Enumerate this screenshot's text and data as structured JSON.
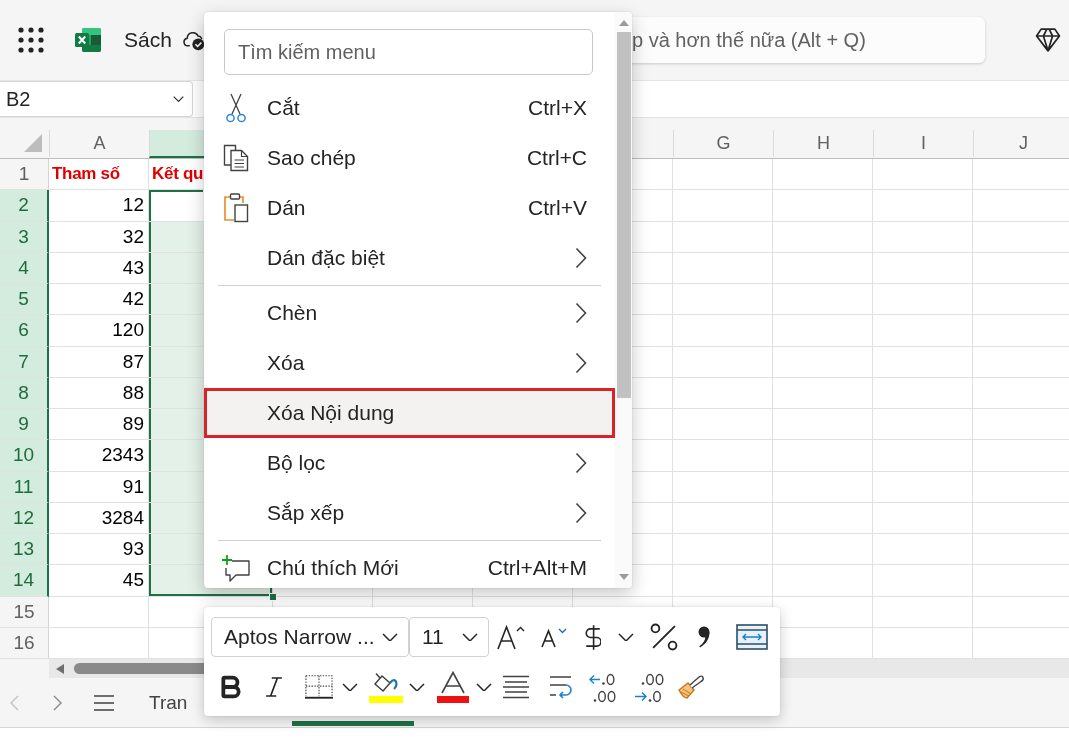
{
  "top_bar": {
    "document_title": "Sách",
    "search": {
      "placeholder": "p và hơn thế nữa (Alt + Q)"
    }
  },
  "name_box": {
    "value": "B2"
  },
  "columns": [
    {
      "label": "A",
      "selected": false
    },
    {
      "selected": true
    },
    {
      "label": "G",
      "selected": false
    },
    {
      "label": "H",
      "selected": false
    },
    {
      "label": "I",
      "selected": false
    },
    {
      "label": "J",
      "selected": false
    }
  ],
  "rows": [
    {
      "header": "1",
      "selected": false,
      "kind": "heading",
      "cells": [
        "Tham số",
        "Kết qu"
      ]
    },
    {
      "header": "2",
      "selected": true,
      "kind": "data",
      "cells": [
        "12"
      ]
    },
    {
      "header": "3",
      "selected": true,
      "kind": "data",
      "cells": [
        "32"
      ]
    },
    {
      "header": "4",
      "selected": true,
      "kind": "data",
      "cells": [
        "43"
      ]
    },
    {
      "header": "5",
      "selected": true,
      "kind": "data",
      "cells": [
        "42"
      ]
    },
    {
      "header": "6",
      "selected": true,
      "kind": "data",
      "cells": [
        "120"
      ]
    },
    {
      "header": "7",
      "selected": true,
      "kind": "data",
      "cells": [
        "87"
      ]
    },
    {
      "header": "8",
      "selected": true,
      "kind": "data",
      "cells": [
        "88"
      ]
    },
    {
      "header": "9",
      "selected": true,
      "kind": "data",
      "cells": [
        "89"
      ]
    },
    {
      "header": "10",
      "selected": true,
      "kind": "data",
      "cells": [
        "2343"
      ]
    },
    {
      "header": "11",
      "selected": true,
      "kind": "data",
      "cells": [
        "91"
      ]
    },
    {
      "header": "12",
      "selected": true,
      "kind": "data",
      "cells": [
        "3284"
      ]
    },
    {
      "header": "13",
      "selected": true,
      "kind": "data",
      "cells": [
        "93"
      ]
    },
    {
      "header": "14",
      "selected": true,
      "kind": "data",
      "cells": [
        "45"
      ]
    },
    {
      "header": "15",
      "selected": false,
      "kind": "data"
    },
    {
      "header": "16",
      "selected": false,
      "kind": "data"
    }
  ],
  "sheet_tabs": [
    {
      "label": "Tran",
      "selected": false
    },
    {
      "selected": true
    }
  ],
  "context_menu": {
    "search": {
      "placeholder": "Tìm kiếm menu"
    },
    "sections": [
      {
        "items": [
          {
            "label": "Cắt",
            "shortcut": "Ctrl+X",
            "submenu": false,
            "selected": false
          },
          {
            "label": "Sao chép",
            "shortcut": "Ctrl+C",
            "submenu": false,
            "selected": false
          },
          {
            "label": "Dán",
            "shortcut": "Ctrl+V",
            "submenu": false,
            "selected": false
          },
          {
            "label": "Dán đặc biệt",
            "submenu": true,
            "selected": false
          }
        ]
      },
      {
        "items": [
          {
            "label": "Chèn",
            "submenu": true,
            "selected": false
          },
          {
            "label": "Xóa",
            "submenu": true,
            "selected": false
          },
          {
            "label": "Xóa Nội dung",
            "submenu": false,
            "selected": true
          },
          {
            "label": "Bộ lọc",
            "submenu": true,
            "selected": false
          },
          {
            "label": "Sắp xếp",
            "submenu": true,
            "selected": false
          }
        ]
      },
      {
        "items": [
          {
            "label": "Chú thích Mới",
            "shortcut": "Ctrl+Alt+M",
            "submenu": false,
            "selected": false
          }
        ]
      }
    ]
  },
  "mini_toolbar": {
    "font_name": {
      "value": "Aptos Narrow ..."
    },
    "font_size": {
      "value": "11"
    }
  }
}
